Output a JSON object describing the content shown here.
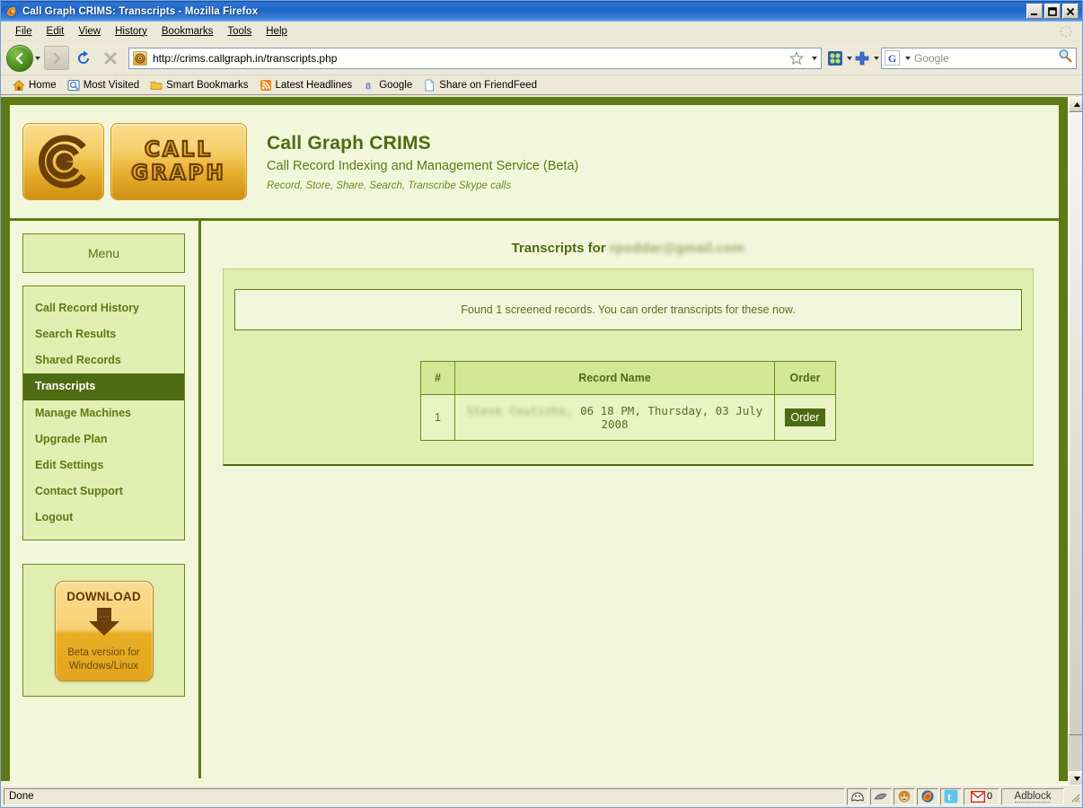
{
  "window": {
    "title": "Call Graph CRIMS: Transcripts - Mozilla Firefox",
    "icon": "firefox-icon",
    "minimize_label": "_",
    "maximize_label": "□",
    "close_label": "✕"
  },
  "menubar": {
    "items": [
      {
        "label": "File",
        "accel": "F"
      },
      {
        "label": "Edit",
        "accel": "E"
      },
      {
        "label": "View",
        "accel": "V"
      },
      {
        "label": "History",
        "accel": "s"
      },
      {
        "label": "Bookmarks",
        "accel": "B"
      },
      {
        "label": "Tools",
        "accel": "T"
      },
      {
        "label": "Help",
        "accel": "H"
      }
    ]
  },
  "toolbar": {
    "back_label": "Back",
    "forward_label": "Forward",
    "reload_label": "Reload",
    "stop_label": "Stop",
    "url": "http://crims.callgraph.in/transcripts.php",
    "bookmark_star": "star-icon",
    "search": {
      "engine": "G",
      "engine_name": "Google",
      "placeholder": "Google",
      "value": ""
    }
  },
  "bookmarks": [
    {
      "label": "Home",
      "icon": "home-icon"
    },
    {
      "label": "Most Visited",
      "icon": "most-visited-icon"
    },
    {
      "label": "Smart Bookmarks",
      "icon": "folder-icon"
    },
    {
      "label": "Latest Headlines",
      "icon": "rss-icon"
    },
    {
      "label": "Google",
      "icon": "google-icon"
    },
    {
      "label": "Share on FriendFeed",
      "icon": "page-icon"
    }
  ],
  "page": {
    "header": {
      "logo_mark": "C",
      "logo_word_line1": "CALL",
      "logo_word_line2": "GRAPH",
      "title": "Call Graph CRIMS",
      "subtitle": "Call Record Indexing and Management Service (Beta)",
      "tagline": "Record, Store, Share, Search, Transcribe Skype calls"
    },
    "sidebar": {
      "menu_heading": "Menu",
      "items": [
        {
          "label": "Call Record History",
          "active": false
        },
        {
          "label": "Search Results",
          "active": false
        },
        {
          "label": "Shared Records",
          "active": false
        },
        {
          "label": "Transcripts",
          "active": true
        },
        {
          "label": "Manage Machines",
          "active": false
        },
        {
          "label": "Upgrade Plan",
          "active": false
        },
        {
          "label": "Edit Settings",
          "active": false
        },
        {
          "label": "Contact Support",
          "active": false
        },
        {
          "label": "Logout",
          "active": false
        }
      ],
      "download": {
        "title": "DOWNLOAD",
        "subtitle_line1": "Beta version for",
        "subtitle_line2": "Windows/Linux",
        "icon": "download-arrow-icon"
      }
    },
    "main": {
      "title_prefix": "Transcripts for",
      "title_account": "rpoddar@gmail.com",
      "notice": "Found 1 screened records. You can order transcripts for these now.",
      "table": {
        "columns": [
          "#",
          "Record Name",
          "Order"
        ],
        "rows": [
          {
            "index": "1",
            "record_name_redacted": "Steve Coutinho,",
            "record_name_rest": "06 18 PM, Thursday, 03 July 2008",
            "order_label": "Order"
          }
        ]
      }
    }
  },
  "statusbar": {
    "status": "Done",
    "icons": [
      {
        "name": "ghostery-icon"
      },
      {
        "name": "shark-fin-icon"
      },
      {
        "name": "monkey-icon"
      },
      {
        "name": "firefox-icon"
      },
      {
        "name": "twitter-icon"
      }
    ],
    "gmail_count": "0",
    "gmail_icon": "gmail-m-icon",
    "adblock_label": "Adblock"
  },
  "colors": {
    "brand_green": "#5d7a14",
    "brand_dark_green": "#4e6b12",
    "panel_green": "#e0eeb0",
    "page_bg": "#f2f7db",
    "logo_gold": "#e8ae2d"
  }
}
